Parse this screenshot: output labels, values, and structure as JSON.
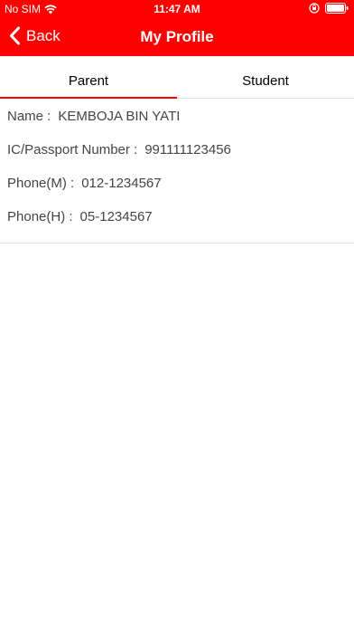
{
  "status_bar": {
    "carrier": "No SIM",
    "time": "11:47 AM"
  },
  "nav": {
    "back_label": "Back",
    "title": "My Profile"
  },
  "tabs": [
    {
      "label": "Parent",
      "active": true
    },
    {
      "label": "Student",
      "active": false
    }
  ],
  "profile": {
    "name_label": "Name :",
    "name_value": "KEMBOJA BIN YATI",
    "ic_label": "IC/Passport Number :",
    "ic_value": "991111123456",
    "phone_m_label": "Phone(M) :",
    "phone_m_value": "012-1234567",
    "phone_h_label": "Phone(H) :",
    "phone_h_value": "05-1234567"
  },
  "colors": {
    "accent": "#fe0000",
    "text": "#444444",
    "divider": "#e2e2e2"
  },
  "icons": [
    "wifi-icon",
    "orientation-lock-icon",
    "battery-icon",
    "chevron-left-icon"
  ]
}
